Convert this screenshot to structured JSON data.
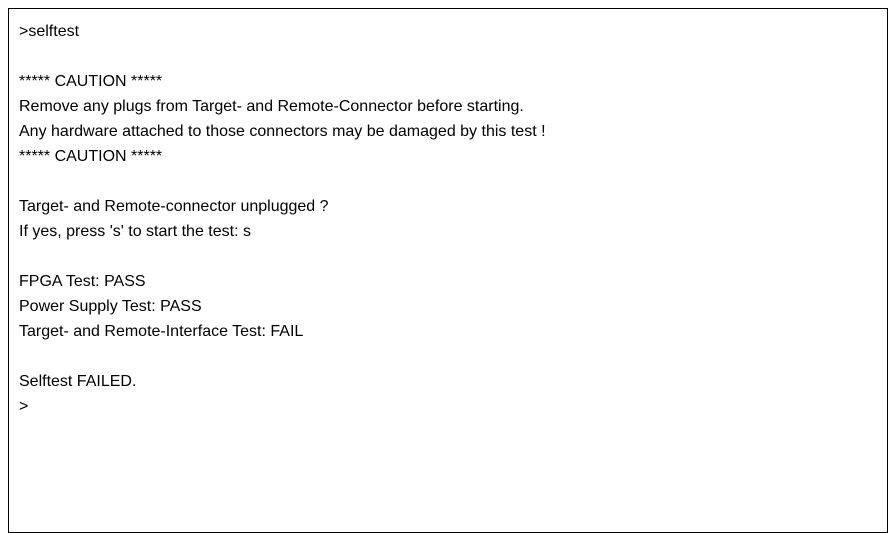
{
  "console": {
    "lines": [
      ">selftest",
      "",
      "***** CAUTION *****",
      "Remove any plugs from Target- and Remote-Connector before starting.",
      "Any hardware attached to those connectors may be damaged by this test !",
      "***** CAUTION *****",
      "",
      "Target- and Remote-connector unplugged ?",
      "If yes, press 's' to start the test: s",
      "",
      "FPGA Test: PASS",
      "Power Supply Test: PASS",
      "Target- and Remote-Interface Test: FAIL",
      "",
      "Selftest FAILED.",
      ">"
    ]
  }
}
